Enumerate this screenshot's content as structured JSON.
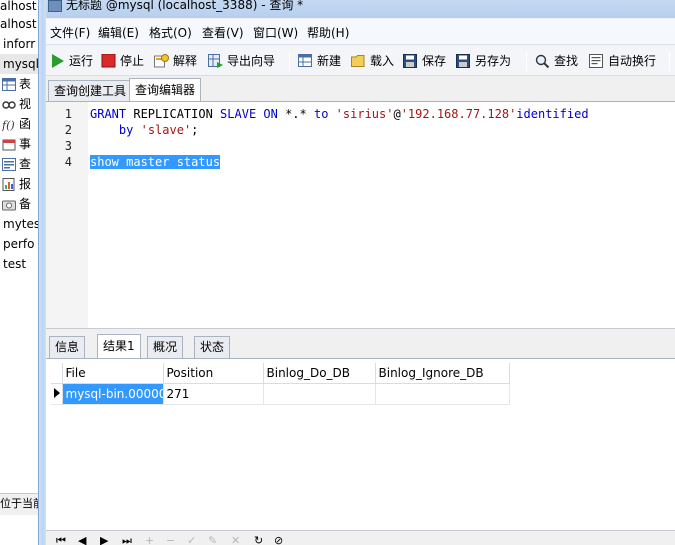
{
  "left_panel": {
    "items": [
      {
        "label": "alhost",
        "icon": "none"
      },
      {
        "label": "alhost",
        "icon": "none"
      },
      {
        "label": "inforr",
        "icon": "none"
      },
      {
        "label": "mysql",
        "icon": "none"
      },
      {
        "label": "表",
        "icon": "table-icon"
      },
      {
        "label": "视",
        "icon": "view-icon"
      },
      {
        "label": "函",
        "icon": "function-icon"
      },
      {
        "label": "事",
        "icon": "event-icon"
      },
      {
        "label": "查",
        "icon": "query-icon"
      },
      {
        "label": "报",
        "icon": "report-icon"
      },
      {
        "label": "备",
        "icon": "backup-icon"
      },
      {
        "label": "mytes",
        "icon": "none"
      },
      {
        "label": "perfo",
        "icon": "none"
      },
      {
        "label": "test",
        "icon": "none"
      }
    ],
    "status_text": "位于当前"
  },
  "window": {
    "title": "无标题 @mysql (localhost_3388) - 查询 *"
  },
  "menu": [
    "文件(F)",
    "编辑(E)",
    "格式(O)",
    "查看(V)",
    "窗口(W)",
    "帮助(H)"
  ],
  "toolbar": {
    "run": "运行",
    "stop": "停止",
    "explain": "解释",
    "export_wizard": "导出向导",
    "new": "新建",
    "load": "载入",
    "save": "保存",
    "save_as": "另存为",
    "find": "查找",
    "auto_wrap": "自动换行"
  },
  "tabs_top": [
    "查询创建工具",
    "查询编辑器"
  ],
  "editor": {
    "line_numbers": [
      "1",
      "2",
      "3",
      "4"
    ],
    "line1": {
      "kw1": "GRANT",
      "t1": " REPLICATION ",
      "kw2": "SLAVE",
      "t2": " ",
      "kw3": "ON",
      "t3": " *.* ",
      "kw4": "to",
      "t4": " ",
      "s1": "'sirius'",
      "t5": "@",
      "s2": "'192.168.77.128'",
      "kw5": "identified"
    },
    "line2": {
      "indent": "    ",
      "kw1": "by",
      "t1": " ",
      "s1": "'slave'",
      "t2": ";"
    },
    "line4": "show master status"
  },
  "tabs_bottom": [
    "信息",
    "结果1",
    "概况",
    "状态"
  ],
  "result_grid": {
    "columns": [
      "File",
      "Position",
      "Binlog_Do_DB",
      "Binlog_Ignore_DB"
    ],
    "rows": [
      [
        "mysql-bin.00000",
        "271",
        "",
        ""
      ]
    ]
  },
  "nav": {
    "first": "⏮",
    "prev": "◀",
    "next": "▶",
    "last": "⏭",
    "add": "+",
    "delete": "−",
    "apply": "✓",
    "edit": "✎",
    "cancel": "✕",
    "refresh": "↻",
    "stop": "⊘"
  },
  "colors": {
    "selection": "#3399ff",
    "keyword": "#0000cc",
    "string": "#a31515"
  }
}
